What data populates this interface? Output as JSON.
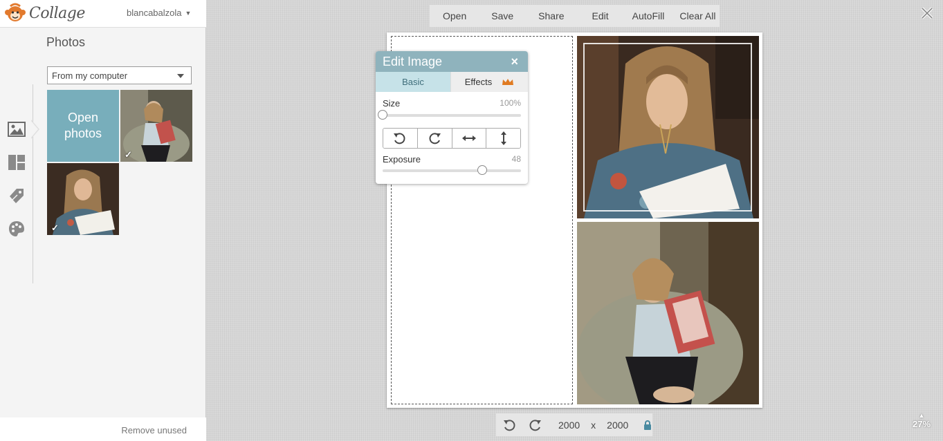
{
  "app": {
    "logo_text": "Collage",
    "username": "blancabalzola"
  },
  "sidebar": {
    "rail_icons": [
      "photos-icon",
      "layouts-icon",
      "stickers-icon",
      "backgrounds-icon"
    ],
    "title": "Photos",
    "source_select": {
      "selected": "From my computer"
    },
    "open_photos_label": "Open photos",
    "remove_unused": "Remove unused"
  },
  "toolbar": {
    "open": "Open",
    "save": "Save",
    "share": "Share",
    "edit": "Edit",
    "autofill": "AutoFill",
    "clear_all": "Clear All"
  },
  "edit_image": {
    "title": "Edit Image",
    "close": "×",
    "tabs": {
      "basic": "Basic",
      "effects": "Effects"
    },
    "size_label": "Size",
    "size_value": "100%",
    "size_fraction": 0.0,
    "exposure_label": "Exposure",
    "exposure_value": "48",
    "exposure_fraction": 0.72
  },
  "canvas_size": {
    "width": "2000",
    "x": "x",
    "height": "2000"
  },
  "zoom": "27%",
  "colors": {
    "accent": "#78aebb",
    "header": "#8fb3bd",
    "tab_active": "#c6e2e8",
    "crown": "#e07b22",
    "lock": "#4a8aa0"
  }
}
